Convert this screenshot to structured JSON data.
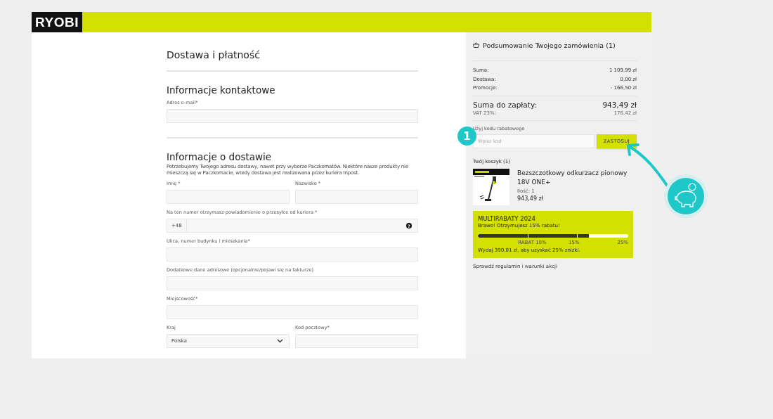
{
  "header": {
    "logo": "RYOBI"
  },
  "form": {
    "title": "Dostawa i płatność",
    "sections": [
      {
        "heading": "Informacje kontaktowe",
        "rows": [
          [
            {
              "kind": "text",
              "label": "Adres e-mail*"
            }
          ]
        ]
      },
      {
        "heading": "Informacje o dostawie",
        "note": "Potrzebujemy Twojego adresu dostawy, nawet przy wyborze Paczkomatów. Niektóre nasze produkty nie mieszczą się w Paczkomacie, wtedy dostawa jest realizowana przez kuriera Inpost.",
        "rows": [
          [
            {
              "kind": "text",
              "label": "Imię *"
            },
            {
              "kind": "text",
              "label": "Nazwisko *"
            }
          ],
          [
            {
              "kind": "phone",
              "label": "Na ten numer otrzymasz powiadomienie o przesyłce od kuriera *",
              "prefix": "+48",
              "help": "?"
            }
          ],
          [
            {
              "kind": "text",
              "label": "Ulica, numer budynku i mieszkania*"
            }
          ],
          [
            {
              "kind": "text",
              "label": "Dodatkowe dane adresowe (opcjonalnie/pojawi się na fakturze)"
            }
          ],
          [
            {
              "kind": "text",
              "label": "Miejscowość*"
            }
          ],
          [
            {
              "kind": "select",
              "label": "Kraj",
              "value": "Polska"
            },
            {
              "kind": "text",
              "label": "Kod pocztowy*"
            }
          ]
        ]
      }
    ]
  },
  "summary": {
    "title": "Podsumowanie Twojego zamówienia (1)",
    "lines": [
      {
        "label": "Suma:",
        "value": "1 109,99 zł"
      },
      {
        "label": "Dostawa:",
        "value": "0,00 zł"
      },
      {
        "label": "Promocje:",
        "value": "- 166,50 zł"
      }
    ],
    "total": {
      "label": "Suma do zapłaty:",
      "value": "943,49 zł"
    },
    "vat": {
      "label": "VAT 23%:",
      "value": "176,42 zł"
    },
    "coupon": {
      "label": "Użyj kodu rabatowego",
      "placeholder": "Wpisz kod",
      "button": "ZASTOSUJ"
    },
    "cart": {
      "title": "Twój koszyk (1)",
      "items": [
        {
          "name": "Bezszczotkowy odkurzacz pionowy 18V ONE+",
          "quantity": "Ilość: 1",
          "price": "943,49 zł"
        }
      ]
    },
    "promo": {
      "title": "MULTIRABATY 2024",
      "message": "Brawo! Otrzymujesz 15% rabatu!",
      "level": 0.74,
      "ticks": [
        "RABAT 10%",
        "15%",
        "25%"
      ],
      "hint": "Wydaj 390,01 zł, aby uzyskać 25% zniżki."
    },
    "terms": "Sprawdź regulamin i warunki akcji"
  },
  "callout": {
    "badge": "1"
  }
}
